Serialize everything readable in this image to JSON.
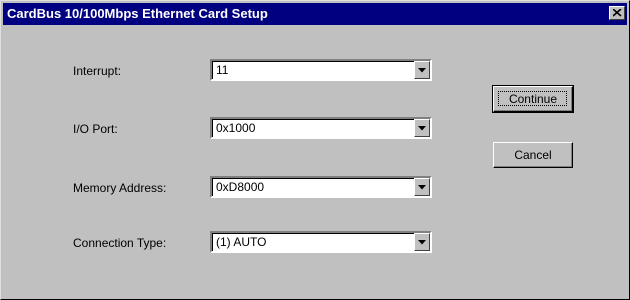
{
  "window": {
    "title": "CardBus 10/100Mbps Ethernet Card Setup"
  },
  "fields": [
    {
      "label": "Interrupt:",
      "value": "11"
    },
    {
      "label": "I/O Port:",
      "value": "0x1000"
    },
    {
      "label": "Memory Address:",
      "value": "0xD8000"
    },
    {
      "label": "Connection Type:",
      "value": "(1) AUTO"
    }
  ],
  "buttons": {
    "continue_label": "Continue",
    "cancel_label": "Cancel"
  },
  "colors": {
    "titlebar": "#000080",
    "face": "#c0c0c0"
  }
}
